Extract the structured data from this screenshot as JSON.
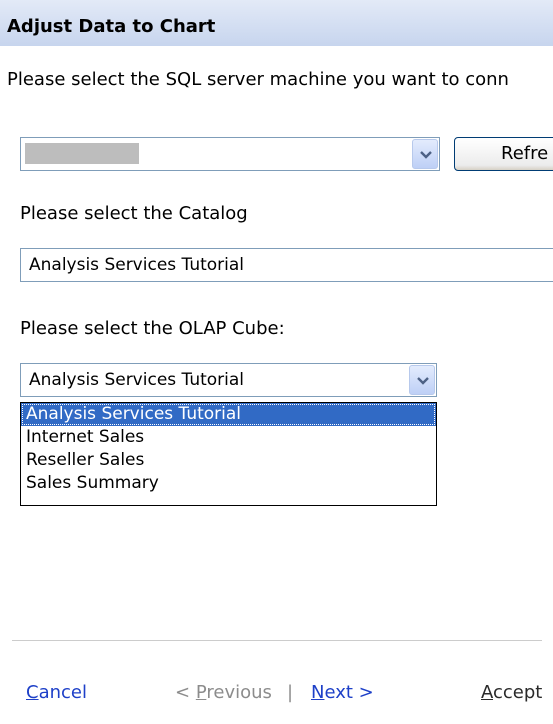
{
  "window": {
    "title": "Adjust Data to Chart"
  },
  "server": {
    "prompt": "Please select the SQL server machine you want to conn",
    "refresh_label": "Refre"
  },
  "catalog": {
    "prompt": "Please select the Catalog",
    "value": "Analysis Services Tutorial"
  },
  "cube": {
    "prompt": "Please select the OLAP Cube:",
    "value": "Analysis Services Tutorial",
    "options": [
      "Analysis Services Tutorial",
      "Internet Sales",
      "Reseller Sales",
      "Sales Summary"
    ],
    "selected_index": 0
  },
  "footer": {
    "cancel_first": "C",
    "cancel_rest": "ancel",
    "previous_pre": "< ",
    "previous_first": "P",
    "previous_rest": "revious",
    "separator": "|",
    "next_first": "N",
    "next_rest": "ext >",
    "accept_first": "A",
    "accept_rest": "ccept"
  },
  "colors": {
    "selection": "#316ac5",
    "link": "#1e40c8",
    "disabled": "#8c8c8c"
  }
}
